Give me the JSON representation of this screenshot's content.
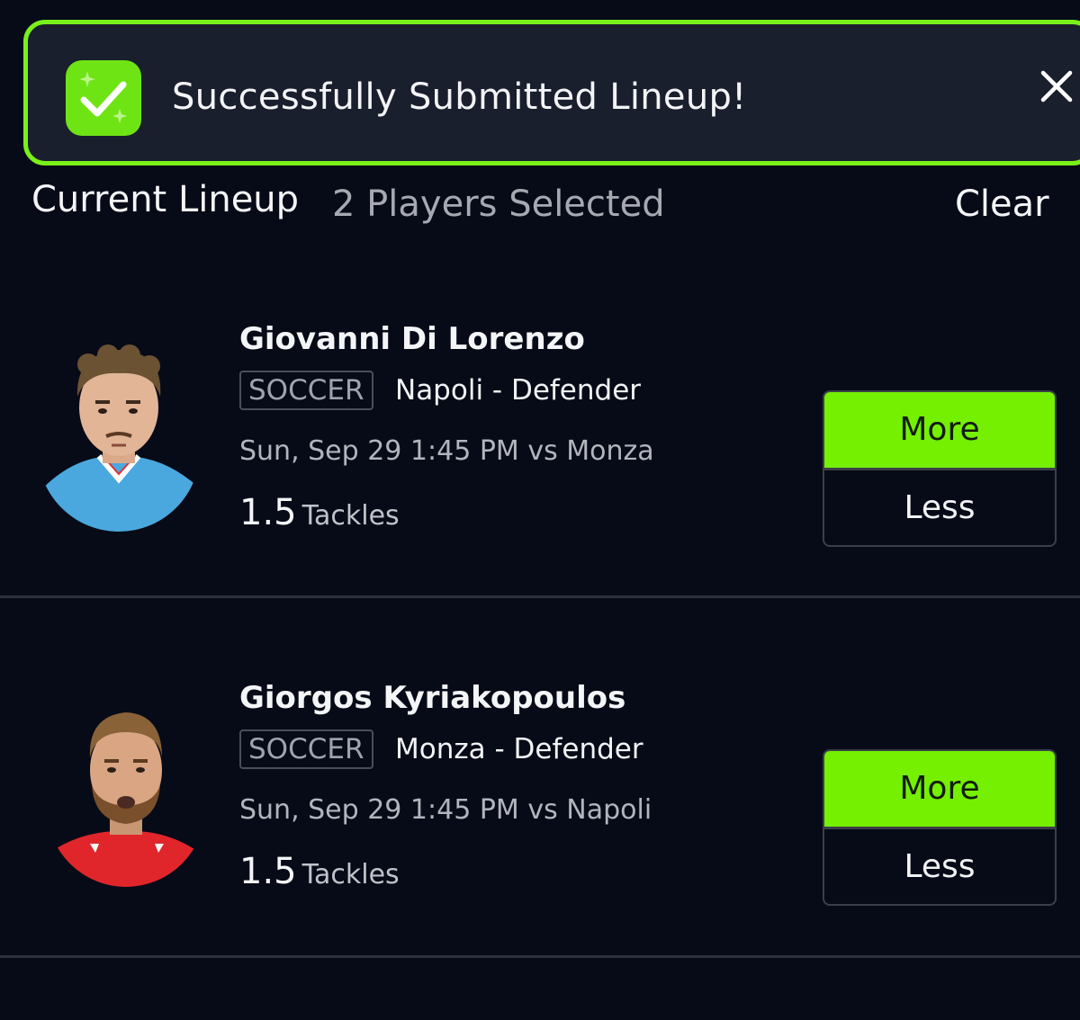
{
  "toast": {
    "message": "Successfully Submitted Lineup!",
    "icon": "check-sparkle-icon",
    "close_icon": "close-icon",
    "accent_color": "#7af01a"
  },
  "lineup_header": {
    "title": "Current Lineup",
    "count": "2 Players Selected",
    "clear_label": "Clear"
  },
  "players": [
    {
      "name": "Giovanni Di Lorenzo",
      "sport": "SOCCER",
      "team_position": "Napoli - Defender",
      "game": "Sun, Sep 29 1:45 PM vs Monza",
      "stat_value": "1.5",
      "stat_label": "Tackles",
      "more_label": "More",
      "less_label": "Less",
      "jersey_color": "#4aa8df"
    },
    {
      "name": "Giorgos Kyriakopoulos",
      "sport": "SOCCER",
      "team_position": "Monza - Defender",
      "game": "Sun, Sep 29 1:45 PM vs Napoli",
      "stat_value": "1.5",
      "stat_label": "Tackles",
      "more_label": "More",
      "less_label": "Less",
      "jersey_color": "#e0262a"
    }
  ],
  "colors": {
    "background": "#070b17",
    "more_button": "#74f000"
  }
}
